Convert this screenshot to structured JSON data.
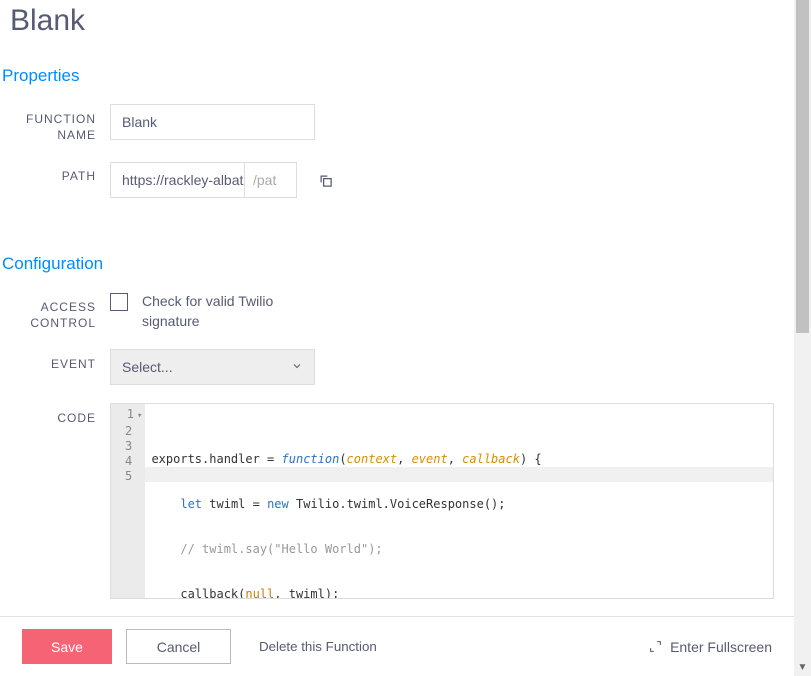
{
  "page": {
    "title": "Blank"
  },
  "sections": {
    "properties": "Properties",
    "configuration": "Configuration"
  },
  "form": {
    "function_name": {
      "label": "FUNCTION NAME",
      "value": "Blank"
    },
    "path": {
      "label": "PATH",
      "base": "https://rackley-albat",
      "placeholder": "/pat"
    },
    "access_control": {
      "label": "ACCESS CONTROL",
      "checkbox_label": "Check for valid Twilio signature",
      "checked": false
    },
    "event": {
      "label": "EVENT",
      "selected": "Select..."
    },
    "code": {
      "label": "CODE",
      "lines": [
        "exports.handler = function(context, event, callback) {",
        "    let twiml = new Twilio.twiml.VoiceResponse();",
        "    // twiml.say(\"Hello World\");",
        "    callback(null, twiml);",
        "};"
      ]
    }
  },
  "footer": {
    "save": "Save",
    "cancel": "Cancel",
    "delete": "Delete this Function",
    "fullscreen": "Enter Fullscreen"
  }
}
